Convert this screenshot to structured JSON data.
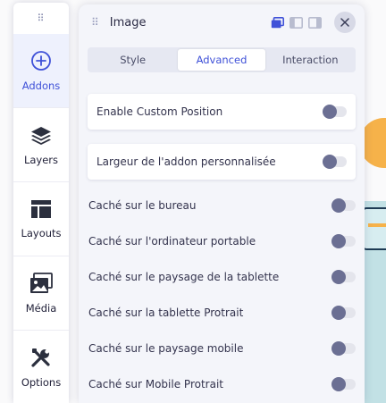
{
  "sidebar": {
    "grip": "⠿",
    "items": [
      {
        "label": "Addons",
        "icon": "plus-circle-icon",
        "active": true
      },
      {
        "label": "Layers",
        "icon": "layers-icon",
        "active": false
      },
      {
        "label": "Layouts",
        "icon": "layout-icon",
        "active": false
      },
      {
        "label": "Média",
        "icon": "media-icon",
        "active": false
      },
      {
        "label": "Options",
        "icon": "tools-icon",
        "active": false
      }
    ]
  },
  "panel": {
    "title": "Image",
    "view_icons": [
      "dock-icon",
      "split-icon",
      "panel-icon"
    ],
    "close_icon": "close-icon",
    "tabs": [
      {
        "label": "Style",
        "active": false
      },
      {
        "label": "Advanced",
        "active": true
      },
      {
        "label": "Interaction",
        "active": false
      }
    ],
    "options": [
      {
        "label": "Enable Custom Position",
        "enabled": false
      },
      {
        "label": "Largeur de l'addon personnalisée",
        "enabled": false
      },
      {
        "label": "Caché sur le bureau",
        "enabled": false
      },
      {
        "label": "Caché sur l'ordinateur portable",
        "enabled": false
      },
      {
        "label": "Caché sur le paysage de la tablette",
        "enabled": false
      },
      {
        "label": "Caché sur la tablette Protrait",
        "enabled": false
      },
      {
        "label": "Caché sur le paysage mobile",
        "enabled": false
      },
      {
        "label": "Caché sur Mobile Protrait",
        "enabled": false
      }
    ]
  },
  "colors": {
    "accent": "#3f51d8",
    "active_bg": "#eef1fd",
    "toggle_knob": "#6b6f93",
    "toggle_track": "#e4e5ec"
  }
}
